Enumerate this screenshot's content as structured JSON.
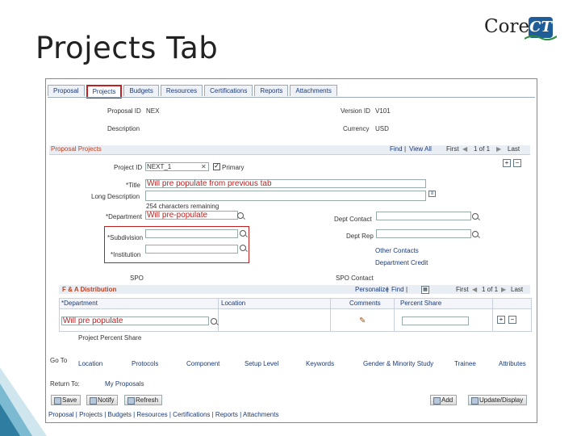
{
  "slide": {
    "title": "Projects Tab"
  },
  "logo": {
    "core": "Core",
    "ct": "CT"
  },
  "tabs": [
    "Proposal",
    "Projects",
    "Budgets",
    "Resources",
    "Certifications",
    "Reports",
    "Attachments"
  ],
  "header": {
    "proposal_id_label": "Proposal ID",
    "proposal_id": "NEX",
    "version_id_label": "Version ID",
    "version_id": "V101",
    "description_label": "Description",
    "currency_label": "Currency",
    "currency": "USD"
  },
  "proposal_projects": {
    "title": "Proposal Projects",
    "find": "Find",
    "view_all": "View All",
    "first": "First",
    "pager": "1 of 1",
    "last": "Last",
    "project_id_label": "Project ID",
    "project_id": "NEXT_1",
    "primary_label": "Primary",
    "title_label": "*Title",
    "title_value": "Will pre populate from previous tab",
    "long_desc_label": "Long Description",
    "chars_remaining": "254 characters remaining",
    "department_label": "*Department",
    "department_value": "Will pre-populate",
    "dept_contact_label": "Dept Contact",
    "subdivision_label": "*Subdivision",
    "dept_rep_label": "Dept Rep",
    "other_contacts_link": "Other Contacts",
    "institution_label": "*Institution",
    "department_credit_link": "Department Credit",
    "spo_label": "SPO",
    "spo_contact_label": "SPO Contact"
  },
  "fa_distribution": {
    "title": "F & A Distribution",
    "personalize": "Personalize",
    "find": "Find",
    "first": "First",
    "pager": "1 of 1",
    "last": "Last",
    "columns": [
      "*Department",
      "Location",
      "Comments",
      "Percent Share"
    ],
    "row_department": "Will pre populate",
    "project_percent_share": "Project Percent Share"
  },
  "goto": {
    "label": "Go To",
    "links": [
      "Location",
      "Protocols",
      "Component",
      "Setup Level",
      "Keywords",
      "Gender & Minority Study",
      "Trainee",
      "Attributes"
    ]
  },
  "return_to": {
    "label": "Return To:",
    "link": "My Proposals"
  },
  "buttons": {
    "save": "Save",
    "notify": "Notify",
    "refresh": "Refresh",
    "add": "Add",
    "update_display": "Update/Display"
  },
  "bottom_links": "Proposal | Projects | Budgets | Resources | Certifications | Reports | Attachments"
}
